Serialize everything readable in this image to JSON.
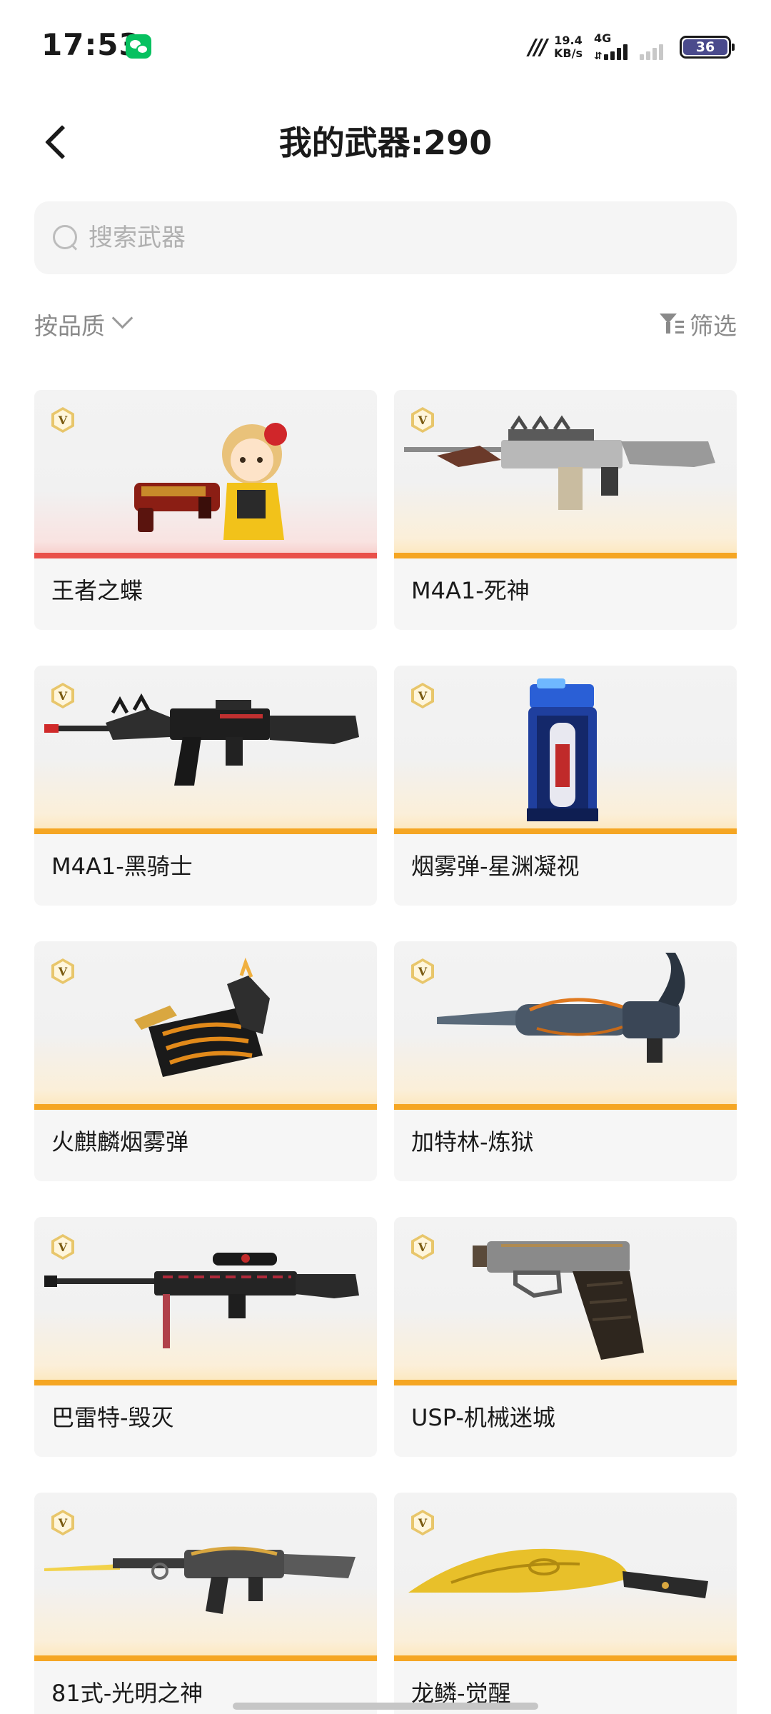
{
  "status_bar": {
    "time": "17:53",
    "speed_value": "19.4",
    "speed_unit": "KB/s",
    "network_type": "4G",
    "battery": "36"
  },
  "header": {
    "title": "我的武器:290"
  },
  "search": {
    "placeholder": "搜索武器"
  },
  "toolbar": {
    "sort_label": "按品质",
    "filter_label": "筛选"
  },
  "weapons": [
    {
      "name": "王者之蝶",
      "badge": "V",
      "accent": "#e9504a"
    },
    {
      "name": "M4A1-死神",
      "badge": "V",
      "accent": "#f5a623"
    },
    {
      "name": "M4A1-黑骑士",
      "badge": "V",
      "accent": "#f5a623"
    },
    {
      "name": "烟雾弹-星渊凝视",
      "badge": "V",
      "accent": "#f5a623"
    },
    {
      "name": "火麒麟烟雾弹",
      "badge": "V",
      "accent": "#f5a623"
    },
    {
      "name": "加特林-炼狱",
      "badge": "V",
      "accent": "#f5a623"
    },
    {
      "name": "巴雷特-毁灭",
      "badge": "V",
      "accent": "#f5a623"
    },
    {
      "name": "USP-机械迷城",
      "badge": "V",
      "accent": "#f5a623"
    },
    {
      "name": "81式-光明之神",
      "badge": "V",
      "accent": "#f5a623"
    },
    {
      "name": "龙鳞-觉醒",
      "badge": "V",
      "accent": "#f5a623"
    }
  ]
}
